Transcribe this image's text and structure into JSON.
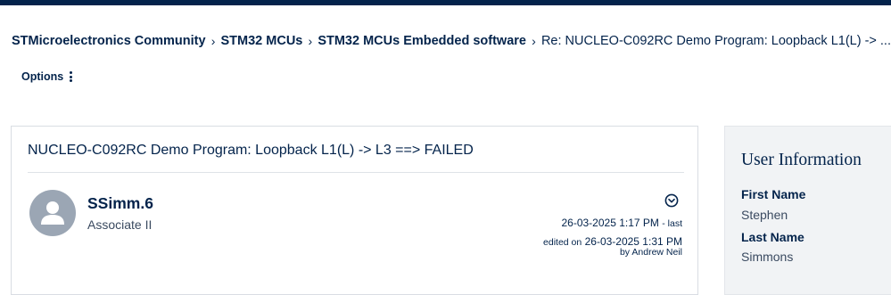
{
  "breadcrumb": {
    "items": [
      {
        "label": "STMicroelectronics Community"
      },
      {
        "label": "STM32 MCUs"
      },
      {
        "label": "STM32 MCUs Embedded software"
      }
    ],
    "separator": "›",
    "current": "Re: NUCLEO-C092RC Demo Program: Loopback L1(L) -> ..."
  },
  "options": {
    "label": "Options"
  },
  "post": {
    "title": "NUCLEO-C092RC Demo Program: Loopback L1(L) -> L3 ==> FAILED",
    "author": {
      "name": "SSimm.6",
      "rank": "Associate II"
    },
    "timestamp": {
      "posted": "26-03-2025 1:17 PM",
      "last_word": "- last",
      "edited_label": "edited on",
      "edited": "26-03-2025 1:31 PM",
      "by_label": "by",
      "editor": "Andrew Neil"
    }
  },
  "user_info": {
    "title": "User Information",
    "fields": [
      {
        "label": "First Name",
        "value": "Stephen"
      },
      {
        "label": "Last Name",
        "value": "Simmons"
      }
    ]
  },
  "colors": {
    "brand_navy": "#03234b",
    "active_underline": "#d6193b",
    "avatar_gray": "#9ba6b4",
    "panel_bg": "#f1f3f5"
  },
  "icons": {
    "options": "vertical-dots-icon",
    "post_menu": "chevron-circle-down-icon",
    "avatar": "user-silhouette-icon"
  }
}
